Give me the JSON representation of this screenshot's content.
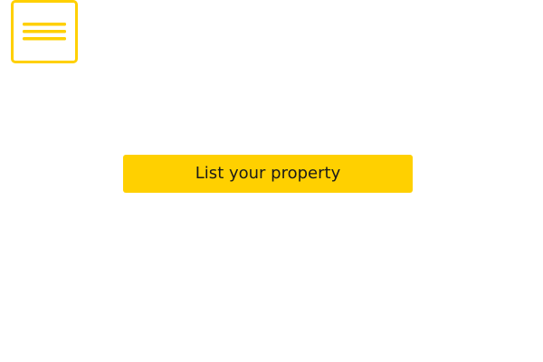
{
  "header": {
    "menu_icon": "hamburger-menu-icon"
  },
  "main": {
    "cta_label": "List your property"
  },
  "colors": {
    "accent": "#ffd000",
    "text": "#1a1a1a",
    "background": "#ffffff"
  }
}
